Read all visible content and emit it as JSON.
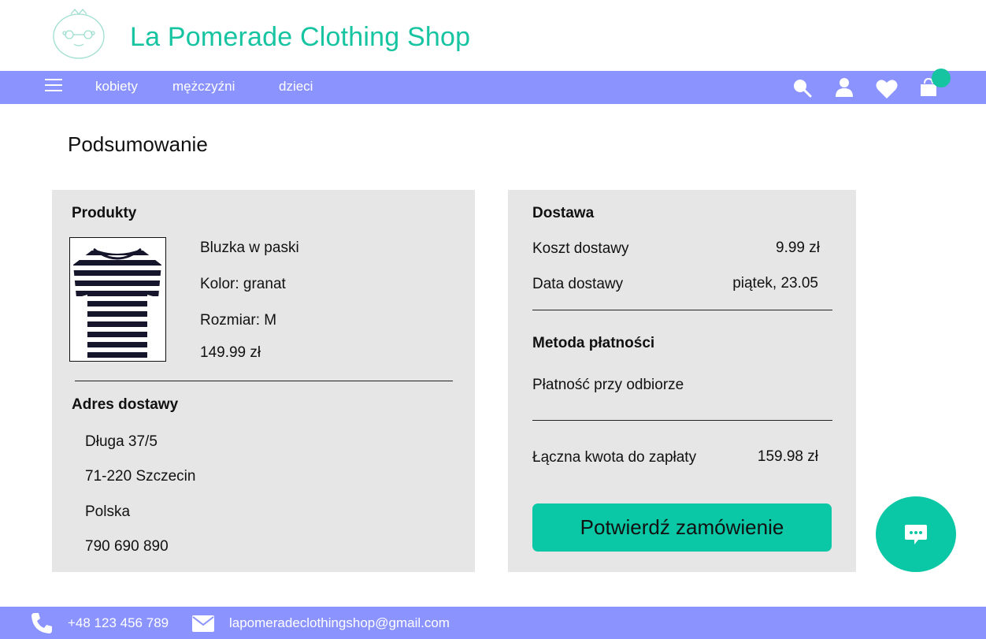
{
  "header": {
    "shop_name": "La Pomerade Clothing Shop"
  },
  "nav": {
    "links": [
      "kobiety",
      "mężczyźni",
      "dzieci"
    ],
    "icons": [
      "menu-icon",
      "search-icon",
      "user-icon",
      "heart-icon",
      "shopping-bag-icon"
    ]
  },
  "page": {
    "title": "Podsumowanie"
  },
  "products": {
    "heading": "Produkty",
    "name": "Bluzka w paski",
    "color": "Kolor: granat",
    "size": "Rozmiar: M",
    "price": "149.99 zł"
  },
  "address": {
    "heading": "Adres dostawy",
    "street": "Długa 37/5",
    "city": "71-220 Szczecin",
    "country": "Polska",
    "phone": "790 690 890"
  },
  "delivery": {
    "heading": "Dostawa",
    "cost_label": "Koszt dostawy",
    "cost_value": "9.99 zł",
    "date_label": "Data dostawy",
    "date_value": "piątek, 23.05"
  },
  "payment": {
    "heading": "Metoda płatności",
    "method": "Płatność przy odbiorze"
  },
  "total": {
    "label": "Łączna kwota do zapłaty",
    "value": "159.98 zł"
  },
  "confirm_label": "Potwierdź zamówienie",
  "footer": {
    "phone": "+48 123 456 789",
    "email": "lapomeradeclothingshop@gmail.com"
  },
  "colors": {
    "accent": "#16c4a2",
    "nav": "#8b93ff",
    "panel": "#e6e6e6"
  }
}
